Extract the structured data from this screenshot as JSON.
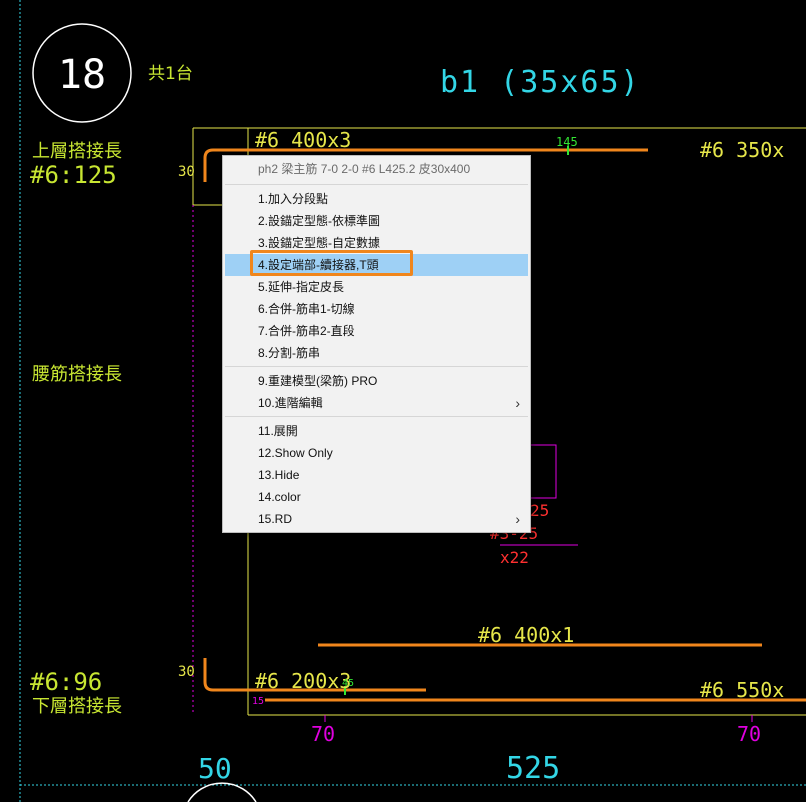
{
  "drawing": {
    "circle_number": "18",
    "qty_label": "共1台",
    "beam_title": "b1 (35x65)",
    "upper_splice_label": "上層搭接長",
    "upper_splice_value": "#6:125",
    "waist_splice_label": "腰筋搭接長",
    "lower_splice_value": "#6:96",
    "lower_splice_label": "下層搭接長",
    "top_rebar_1": "#6 400x3",
    "top_rebar_2": "#6 350x",
    "top_dim_145": "145",
    "hook_30_top": "30",
    "hook_30_bottom": "30",
    "mid_rebar": "#6 400x1",
    "bottom_rebar_1": "#6 200x3",
    "bottom_rebar_2": "#6 550x",
    "bottom_dim_15": "15",
    "bottom_dim_45": "45",
    "stirrup_1": "25",
    "stirrup_2": "#3-25",
    "stirrup_3": "x22",
    "dim_70_left": "70",
    "dim_70_right": "70",
    "dim_50": "50",
    "dim_525": "525",
    "colors": {
      "background": "#000000",
      "cyan": "#33d6e6",
      "yellow_green": "#c8e632",
      "orange": "#f0861c",
      "magenta": "#e000e0",
      "yellow": "#e6e64a",
      "red": "#ff3030",
      "green": "#33e633"
    }
  },
  "context_menu": {
    "header": "ph2 梁主筋 7-0 2-0 #6 L425.2 皮30x400",
    "items": [
      {
        "label": "1.加入分段點"
      },
      {
        "label": "2.設錨定型態-依標準圖"
      },
      {
        "label": "3.設錨定型態-自定數據"
      },
      {
        "label": "4.設定端部-續接器,T頭"
      },
      {
        "label": "5.延伸-指定皮長"
      },
      {
        "label": "6.合併-筋串1-切線"
      },
      {
        "label": "7.合併-筋串2-直段"
      },
      {
        "label": "8.分割-筋串"
      },
      {
        "label": "9.重建模型(梁筋) PRO"
      },
      {
        "label": "10.進階編輯"
      },
      {
        "label": "11.展開"
      },
      {
        "label": "12.Show Only"
      },
      {
        "label": "13.Hide"
      },
      {
        "label": "14.color"
      },
      {
        "label": "15.RD"
      }
    ],
    "submenu_arrow": "›"
  }
}
